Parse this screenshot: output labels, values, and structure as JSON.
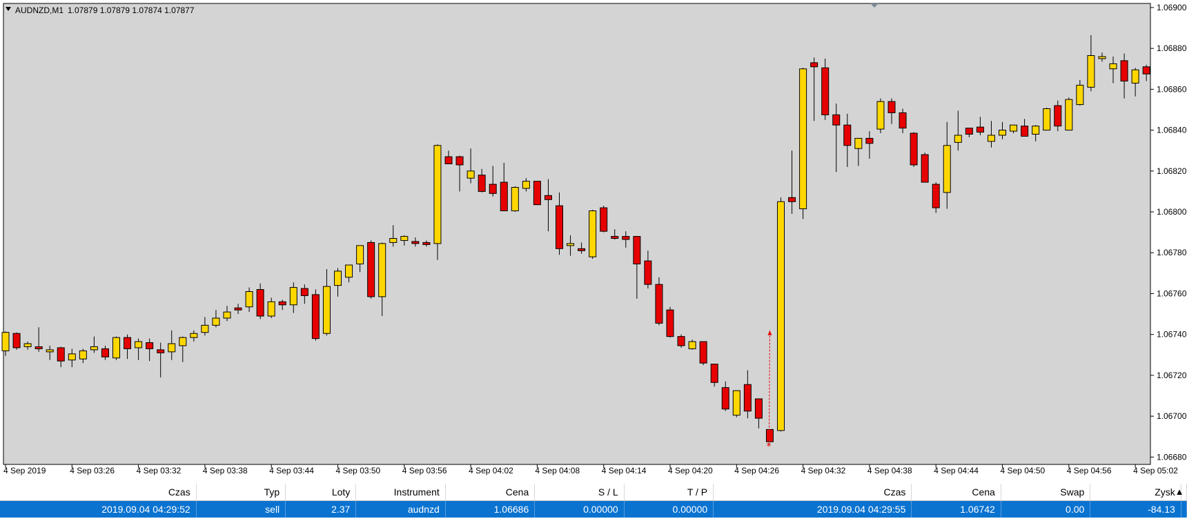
{
  "chart_header": {
    "symbol": "AUDNZD,M1",
    "ohlc": "1.07879 1.07879 1.07874 1.07877",
    "menu_arrow_icon": "triangle-down-icon"
  },
  "colors": {
    "background": "#d4d4d4",
    "bull_candle": "#ffd700",
    "bear_candle": "#e60000",
    "trade_line": "#e60000",
    "table_selected": "#0a73d0"
  },
  "chart_data": {
    "type": "candlestick",
    "y_ticks": [
      "1.06900",
      "1.06880",
      "1.06860",
      "1.06840",
      "1.06820",
      "1.06800",
      "1.06780",
      "1.06760",
      "1.06740",
      "1.06720",
      "1.06700",
      "1.06680"
    ],
    "x_tick_labels": [
      "4 Sep 2019",
      "4 Sep 03:26",
      "4 Sep 03:32",
      "4 Sep 03:38",
      "4 Sep 03:44",
      "4 Sep 03:50",
      "4 Sep 03:56",
      "4 Sep 04:02",
      "4 Sep 04:08",
      "4 Sep 04:14",
      "4 Sep 04:20",
      "4 Sep 04:26",
      "4 Sep 04:32",
      "4 Sep 04:38",
      "4 Sep 04:44",
      "4 Sep 04:50",
      "4 Sep 04:56",
      "4 Sep 05:02"
    ],
    "ylim": [
      1.066764,
      1.06902
    ],
    "candles": [
      {
        "o": 1.06732,
        "h": 1.067415,
        "l": 1.067295,
        "c": 1.06741
      },
      {
        "o": 1.067405,
        "h": 1.06741,
        "l": 1.067325,
        "c": 1.067335
      },
      {
        "o": 1.06734,
        "h": 1.067365,
        "l": 1.067325,
        "c": 1.067355
      },
      {
        "o": 1.06734,
        "h": 1.067435,
        "l": 1.067315,
        "c": 1.06733
      },
      {
        "o": 1.067325,
        "h": 1.067345,
        "l": 1.067275,
        "c": 1.067325
      },
      {
        "o": 1.067335,
        "h": 1.06734,
        "l": 1.06724,
        "c": 1.06727
      },
      {
        "o": 1.067275,
        "h": 1.06733,
        "l": 1.06724,
        "c": 1.067305
      },
      {
        "o": 1.06728,
        "h": 1.06733,
        "l": 1.06726,
        "c": 1.06732
      },
      {
        "o": 1.067325,
        "h": 1.06739,
        "l": 1.06731,
        "c": 1.06734
      },
      {
        "o": 1.06733,
        "h": 1.067345,
        "l": 1.067275,
        "c": 1.06729
      },
      {
        "o": 1.067285,
        "h": 1.06739,
        "l": 1.067275,
        "c": 1.067385
      },
      {
        "o": 1.067385,
        "h": 1.0674,
        "l": 1.06728,
        "c": 1.06733
      },
      {
        "o": 1.067335,
        "h": 1.06738,
        "l": 1.067275,
        "c": 1.067365
      },
      {
        "o": 1.06736,
        "h": 1.06738,
        "l": 1.06727,
        "c": 1.06733
      },
      {
        "o": 1.067325,
        "h": 1.06736,
        "l": 1.06719,
        "c": 1.06731
      },
      {
        "o": 1.067315,
        "h": 1.06742,
        "l": 1.067275,
        "c": 1.067355
      },
      {
        "o": 1.067345,
        "h": 1.06739,
        "l": 1.067265,
        "c": 1.067385
      },
      {
        "o": 1.067385,
        "h": 1.06742,
        "l": 1.067365,
        "c": 1.067405
      },
      {
        "o": 1.06741,
        "h": 1.067485,
        "l": 1.067395,
        "c": 1.067445
      },
      {
        "o": 1.067445,
        "h": 1.06752,
        "l": 1.067435,
        "c": 1.06748
      },
      {
        "o": 1.06748,
        "h": 1.06754,
        "l": 1.067465,
        "c": 1.06751
      },
      {
        "o": 1.06753,
        "h": 1.06755,
        "l": 1.0675,
        "c": 1.06752
      },
      {
        "o": 1.067535,
        "h": 1.06763,
        "l": 1.06751,
        "c": 1.06761
      },
      {
        "o": 1.06762,
        "h": 1.06765,
        "l": 1.067475,
        "c": 1.06749
      },
      {
        "o": 1.06749,
        "h": 1.06758,
        "l": 1.06748,
        "c": 1.06756
      },
      {
        "o": 1.06756,
        "h": 1.06757,
        "l": 1.06752,
        "c": 1.067545
      },
      {
        "o": 1.067545,
        "h": 1.067655,
        "l": 1.067505,
        "c": 1.06763
      },
      {
        "o": 1.067625,
        "h": 1.067645,
        "l": 1.06755,
        "c": 1.06759
      },
      {
        "o": 1.067595,
        "h": 1.06762,
        "l": 1.06737,
        "c": 1.06738
      },
      {
        "o": 1.067405,
        "h": 1.06772,
        "l": 1.067395,
        "c": 1.067635
      },
      {
        "o": 1.06764,
        "h": 1.067725,
        "l": 1.067585,
        "c": 1.06771
      },
      {
        "o": 1.06768,
        "h": 1.067735,
        "l": 1.067655,
        "c": 1.06774
      },
      {
        "o": 1.067745,
        "h": 1.067835,
        "l": 1.067705,
        "c": 1.067835
      },
      {
        "o": 1.06785,
        "h": 1.06786,
        "l": 1.067575,
        "c": 1.067585
      },
      {
        "o": 1.067585,
        "h": 1.06785,
        "l": 1.06749,
        "c": 1.067845
      },
      {
        "o": 1.06785,
        "h": 1.067935,
        "l": 1.06783,
        "c": 1.06787
      },
      {
        "o": 1.06786,
        "h": 1.067885,
        "l": 1.067835,
        "c": 1.06788
      },
      {
        "o": 1.067855,
        "h": 1.067875,
        "l": 1.06783,
        "c": 1.067845
      },
      {
        "o": 1.06785,
        "h": 1.06786,
        "l": 1.06783,
        "c": 1.067845
      },
      {
        "o": 1.067845,
        "h": 1.06833,
        "l": 1.067765,
        "c": 1.068325
      },
      {
        "o": 1.06827,
        "h": 1.0683,
        "l": 1.06824,
        "c": 1.068235
      },
      {
        "o": 1.06827,
        "h": 1.068275,
        "l": 1.0681,
        "c": 1.06823
      },
      {
        "o": 1.068165,
        "h": 1.06831,
        "l": 1.06814,
        "c": 1.0682
      },
      {
        "o": 1.06818,
        "h": 1.06821,
        "l": 1.068095,
        "c": 1.0681
      },
      {
        "o": 1.068135,
        "h": 1.068225,
        "l": 1.068075,
        "c": 1.06809
      },
      {
        "o": 1.068145,
        "h": 1.06824,
        "l": 1.068135,
        "c": 1.068005
      },
      {
        "o": 1.068005,
        "h": 1.068125,
        "l": 1.068,
        "c": 1.06812
      },
      {
        "o": 1.068115,
        "h": 1.068165,
        "l": 1.0681,
        "c": 1.06815
      },
      {
        "o": 1.06815,
        "h": 1.068145,
        "l": 1.06804,
        "c": 1.068035
      },
      {
        "o": 1.06808,
        "h": 1.06816,
        "l": 1.067905,
        "c": 1.06806
      },
      {
        "o": 1.06803,
        "h": 1.068095,
        "l": 1.06779,
        "c": 1.06782
      },
      {
        "o": 1.067835,
        "h": 1.067885,
        "l": 1.067785,
        "c": 1.067845
      },
      {
        "o": 1.06782,
        "h": 1.06785,
        "l": 1.067795,
        "c": 1.067815
      },
      {
        "o": 1.06778,
        "h": 1.06801,
        "l": 1.06777,
        "c": 1.068005
      },
      {
        "o": 1.06802,
        "h": 1.06803,
        "l": 1.0679,
        "c": 1.067905
      },
      {
        "o": 1.06788,
        "h": 1.067915,
        "l": 1.067865,
        "c": 1.06787
      },
      {
        "o": 1.06788,
        "h": 1.067905,
        "l": 1.067825,
        "c": 1.067865
      },
      {
        "o": 1.06788,
        "h": 1.06778,
        "l": 1.067575,
        "c": 1.067745
      },
      {
        "o": 1.06776,
        "h": 1.06781,
        "l": 1.067625,
        "c": 1.067645
      },
      {
        "o": 1.067645,
        "h": 1.06768,
        "l": 1.067445,
        "c": 1.067455
      },
      {
        "o": 1.06752,
        "h": 1.067535,
        "l": 1.067385,
        "c": 1.06739
      },
      {
        "o": 1.06739,
        "h": 1.0674,
        "l": 1.067335,
        "c": 1.067345
      },
      {
        "o": 1.06733,
        "h": 1.067375,
        "l": 1.067325,
        "c": 1.067365
      },
      {
        "o": 1.067365,
        "h": 1.06736,
        "l": 1.06725,
        "c": 1.06726
      },
      {
        "o": 1.067255,
        "h": 1.067235,
        "l": 1.067145,
        "c": 1.067165
      },
      {
        "o": 1.06714,
        "h": 1.06717,
        "l": 1.067025,
        "c": 1.067035
      },
      {
        "o": 1.067005,
        "h": 1.067125,
        "l": 1.066995,
        "c": 1.067125
      },
      {
        "o": 1.067155,
        "h": 1.067225,
        "l": 1.06699,
        "c": 1.067025
      },
      {
        "o": 1.067085,
        "h": 1.067085,
        "l": 1.06694,
        "c": 1.06699
      },
      {
        "o": 1.066935,
        "h": 1.066915,
        "l": 1.066885,
        "c": 1.066875
      },
      {
        "o": 1.06693,
        "h": 1.06807,
        "l": 1.066925,
        "c": 1.06805
      },
      {
        "o": 1.06807,
        "h": 1.0683,
        "l": 1.06799,
        "c": 1.06805
      },
      {
        "o": 1.068015,
        "h": 1.068705,
        "l": 1.067965,
        "c": 1.0687
      },
      {
        "o": 1.06873,
        "h": 1.068755,
        "l": 1.068445,
        "c": 1.06871
      },
      {
        "o": 1.068705,
        "h": 1.06875,
        "l": 1.06845,
        "c": 1.068475
      },
      {
        "o": 1.068475,
        "h": 1.06853,
        "l": 1.068195,
        "c": 1.068425
      },
      {
        "o": 1.068425,
        "h": 1.06848,
        "l": 1.06822,
        "c": 1.068325
      },
      {
        "o": 1.06831,
        "h": 1.06833,
        "l": 1.068225,
        "c": 1.06836
      },
      {
        "o": 1.06836,
        "h": 1.068395,
        "l": 1.06826,
        "c": 1.068335
      },
      {
        "o": 1.068405,
        "h": 1.068555,
        "l": 1.068385,
        "c": 1.06854
      },
      {
        "o": 1.06854,
        "h": 1.068555,
        "l": 1.06843,
        "c": 1.068485
      },
      {
        "o": 1.068485,
        "h": 1.068505,
        "l": 1.068385,
        "c": 1.06841
      },
      {
        "o": 1.068385,
        "h": 1.06839,
        "l": 1.06822,
        "c": 1.06823
      },
      {
        "o": 1.06828,
        "h": 1.06829,
        "l": 1.06815,
        "c": 1.068145
      },
      {
        "o": 1.068135,
        "h": 1.068145,
        "l": 1.067995,
        "c": 1.06802
      },
      {
        "o": 1.068095,
        "h": 1.06844,
        "l": 1.068015,
        "c": 1.068325
      },
      {
        "o": 1.06834,
        "h": 1.068495,
        "l": 1.0683,
        "c": 1.068375
      },
      {
        "o": 1.06841,
        "h": 1.06841,
        "l": 1.068365,
        "c": 1.06838
      },
      {
        "o": 1.068415,
        "h": 1.068465,
        "l": 1.068375,
        "c": 1.06839
      },
      {
        "o": 1.068345,
        "h": 1.068445,
        "l": 1.068315,
        "c": 1.068375
      },
      {
        "o": 1.068375,
        "h": 1.06844,
        "l": 1.068355,
        "c": 1.0684
      },
      {
        "o": 1.068395,
        "h": 1.068425,
        "l": 1.068385,
        "c": 1.068425
      },
      {
        "o": 1.06842,
        "h": 1.068455,
        "l": 1.06839,
        "c": 1.06837
      },
      {
        "o": 1.06838,
        "h": 1.068425,
        "l": 1.068345,
        "c": 1.06842
      },
      {
        "o": 1.0684,
        "h": 1.06851,
        "l": 1.0684,
        "c": 1.068505
      },
      {
        "o": 1.06852,
        "h": 1.068545,
        "l": 1.068395,
        "c": 1.06842
      },
      {
        "o": 1.0684,
        "h": 1.06856,
        "l": 1.0684,
        "c": 1.06855
      },
      {
        "o": 1.068525,
        "h": 1.068645,
        "l": 1.06852,
        "c": 1.06862
      },
      {
        "o": 1.06861,
        "h": 1.068865,
        "l": 1.06859,
        "c": 1.068765
      },
      {
        "o": 1.068755,
        "h": 1.06878,
        "l": 1.068735,
        "c": 1.06876
      },
      {
        "o": 1.0687,
        "h": 1.06876,
        "l": 1.06863,
        "c": 1.068725
      },
      {
        "o": 1.06874,
        "h": 1.068775,
        "l": 1.068555,
        "c": 1.06864
      },
      {
        "o": 1.06863,
        "h": 1.068705,
        "l": 1.068565,
        "c": 1.068695
      },
      {
        "o": 1.06871,
        "h": 1.06872,
        "l": 1.06864,
        "c": 1.068675
      }
    ],
    "trade": {
      "open_price": 1.06686,
      "close_price": 1.06742,
      "open_candle": 69,
      "close_candle": 69
    }
  },
  "trade_table": {
    "headers": [
      "Czas",
      "Typ",
      "Loty",
      "Instrument",
      "Cena",
      "S / L",
      "T / P",
      "Czas",
      "Cena",
      "Swap",
      "Zysk"
    ],
    "rows": [
      [
        "2019.09.04 04:29:52",
        "sell",
        "2.37",
        "audnzd",
        "1.06686",
        "0.00000",
        "0.00000",
        "2019.09.04 04:29:55",
        "1.06742",
        "0.00",
        "-84.13"
      ]
    ]
  },
  "scroll_up_icon": "caret-up-icon"
}
